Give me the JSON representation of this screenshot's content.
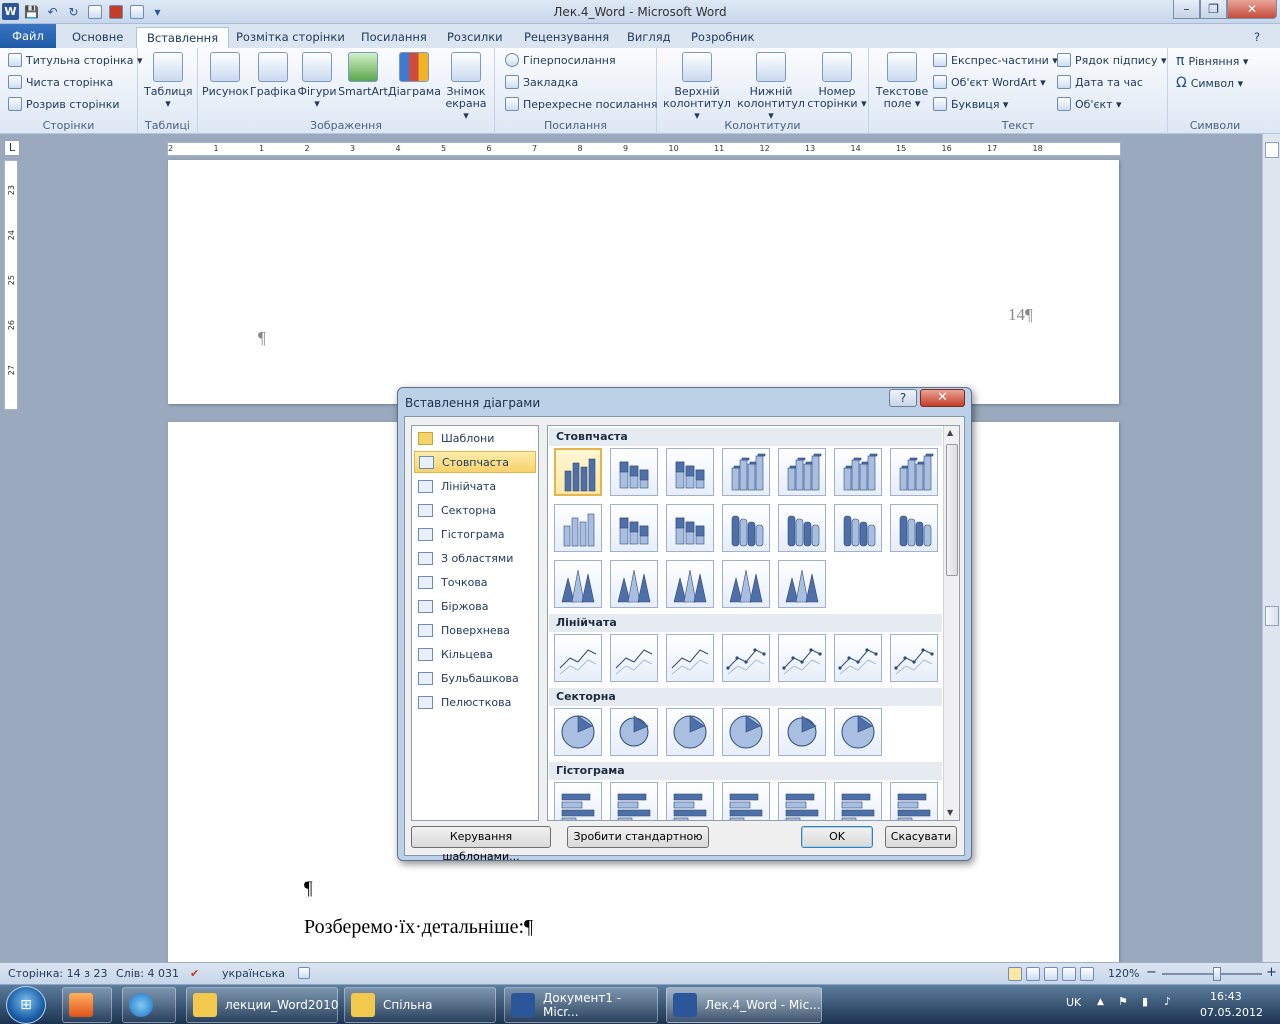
{
  "window": {
    "title": "Лек.4_Word  -  Microsoft Word",
    "minimize": "–",
    "restore": "❐",
    "close": "✕"
  },
  "qat": {
    "save": "💾",
    "undo": "↶",
    "redo": "↻",
    "icons": [
      "save-icon",
      "undo-icon",
      "redo-icon",
      "print-preview-icon",
      "close-doc-icon"
    ]
  },
  "tabs": {
    "file": "Файл",
    "items": [
      "Основне",
      "Вставлення",
      "Розмітка сторінки",
      "Посилання",
      "Розсилки",
      "Рецензування",
      "Вигляд",
      "Розробник"
    ],
    "help": "?"
  },
  "ribbon": {
    "pages": {
      "label": "Сторінки",
      "cover": "Титульна сторінка ▾",
      "blank": "Чиста сторінка",
      "break": "Розрив сторінки"
    },
    "tables": {
      "label": "Таблиці",
      "table": "Таблиця",
      "arrow": "▾"
    },
    "illustrations": {
      "label": "Зображення",
      "picture": "Рисунок",
      "clipart": "Графіка",
      "shapes": "Фігури",
      "shapes_arrow": "▾",
      "smartart": "SmartArt",
      "chart": "Діаграма",
      "screenshot": "Знімок",
      "screenshot2": "екрана ▾"
    },
    "links": {
      "label": "Посилання",
      "hyperlink": "Гіперпосилання",
      "bookmark": "Закладка",
      "crossref": "Перехресне посилання"
    },
    "headerfooter": {
      "label": "Колонтитули",
      "header": "Верхній",
      "header2": "колонтитул ▾",
      "footer": "Нижній",
      "footer2": "колонтитул ▾",
      "pagenum": "Номер",
      "pagenum2": "сторінки ▾"
    },
    "text": {
      "label": "Текст",
      "textbox": "Текстове",
      "textbox2": "поле ▾",
      "quickparts": "Експрес-частини ▾",
      "wordart": "Об'єкт WordArt ▾",
      "dropcap": "Буквиця ▾",
      "sigline": "Рядок підпису ▾",
      "datetime": "Дата та час",
      "object": "Об'єкт ▾"
    },
    "symbols": {
      "label": "Символи",
      "equation": "Рівняння ▾",
      "symbol": "Символ ▾",
      "pi": "π",
      "omega": "Ω"
    }
  },
  "ruler": {
    "marks": [
      "2",
      "1",
      "1",
      "2",
      "3",
      "4",
      "5",
      "6",
      "7",
      "8",
      "9",
      "10",
      "11",
      "12",
      "13",
      "14",
      "15",
      "16",
      "17",
      "18"
    ],
    "vmarks": [
      "23",
      "24",
      "25",
      "26",
      "27"
    ],
    "corner": "L"
  },
  "document": {
    "page_number": "14¶",
    "pilcrow": "¶",
    "pilcrow2": "¶",
    "text_line": "Розберемо·їх·детальніше:¶"
  },
  "dialog": {
    "title": "Вставлення діаграми",
    "help": "?",
    "close": "✕",
    "categories": [
      {
        "label": "Шаблони",
        "icon": "folder-icon"
      },
      {
        "label": "Стовпчаста",
        "icon": "column-chart-icon",
        "selected": true
      },
      {
        "label": "Лінійчата",
        "icon": "line-chart-icon"
      },
      {
        "label": "Секторна",
        "icon": "pie-chart-icon"
      },
      {
        "label": "Гістограма",
        "icon": "bar-chart-icon"
      },
      {
        "label": "З областями",
        "icon": "area-chart-icon"
      },
      {
        "label": "Точкова",
        "icon": "scatter-chart-icon"
      },
      {
        "label": "Біржова",
        "icon": "stock-chart-icon"
      },
      {
        "label": "Поверхнева",
        "icon": "surface-chart-icon"
      },
      {
        "label": "Кільцева",
        "icon": "doughnut-chart-icon"
      },
      {
        "label": "Бульбашкова",
        "icon": "bubble-chart-icon"
      },
      {
        "label": "Пелюсткова",
        "icon": "radar-chart-icon"
      }
    ],
    "sections": {
      "column": "Стовпчаста",
      "line": "Лінійчата",
      "pie": "Секторна",
      "bar": "Гістограма"
    },
    "buttons": {
      "manage": "Керування шаблонами...",
      "default": "Зробити стандартною",
      "ok": "OK",
      "cancel": "Скасувати"
    }
  },
  "status": {
    "page": "Сторінка: 14 з 23",
    "words": "Слів: 4 031",
    "language": "українська",
    "zoom": "120%",
    "zoom_minus": "−",
    "zoom_plus": "+",
    "zoom_fraction": 0.55
  },
  "taskbar": {
    "start": "⊞",
    "items": [
      {
        "label": "лекции_Word2010",
        "icon": "folder-icon",
        "color": "#f2c94c"
      },
      {
        "label": "Спільна",
        "icon": "folder-icon",
        "color": "#f2c94c"
      },
      {
        "label": "Документ1 - Micr...",
        "icon": "word-icon",
        "color": "#2b579a"
      },
      {
        "label": "Лек.4_Word - Mic...",
        "icon": "word-icon",
        "color": "#2b579a",
        "active": true
      }
    ],
    "lang": "UK",
    "time": "16:43",
    "date": "07.05.2012"
  },
  "colors": {
    "accent": "#2b579a",
    "selection": "#f8d26c",
    "dialog_frame": "#bcd0e8"
  }
}
